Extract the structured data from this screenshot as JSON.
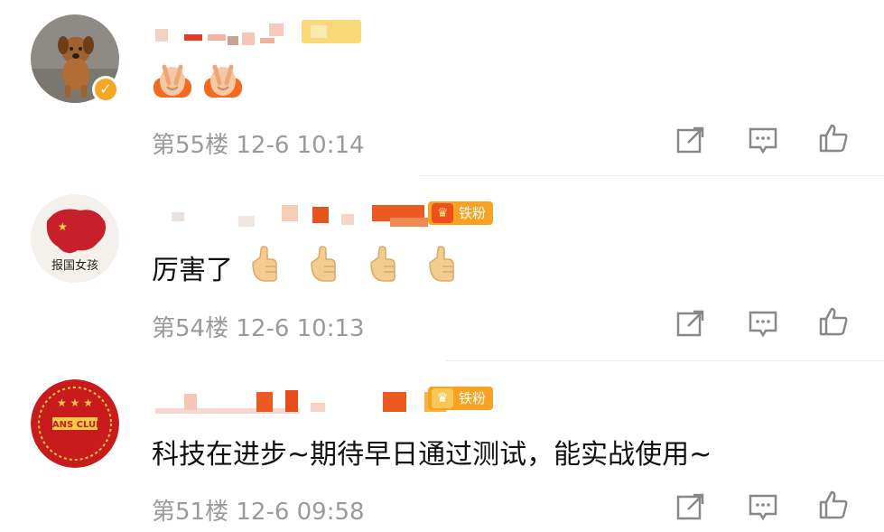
{
  "comments": [
    {
      "avatar": "dog-avatar",
      "verified": true,
      "text": "",
      "emojis": [
        "clap-hands-emoji",
        "clap-hands-emoji"
      ],
      "floor": "第55楼",
      "date": "12-6",
      "time": "10:14"
    },
    {
      "avatar": "china-map-avatar",
      "badge": "铁粉",
      "text": "厉害了",
      "emojis": [
        "thumbs-up-emoji",
        "thumbs-up-emoji",
        "thumbs-up-emoji",
        "thumbs-up-emoji"
      ],
      "floor": "第54楼",
      "date": "12-6",
      "time": "10:13"
    },
    {
      "avatar": "fans-club-avatar",
      "avatar_text": "FANS CLUB",
      "badge": "铁粉",
      "text": "科技在进步~期待早日通过测试，能实战使用~",
      "floor": "第51楼",
      "date": "12-6",
      "time": "09:58"
    }
  ],
  "actions": [
    "share-icon",
    "comment-icon",
    "like-icon"
  ],
  "colors": {
    "accent": "#f7a321",
    "meta": "#9a9a9a",
    "badge": "#f04d1c"
  }
}
